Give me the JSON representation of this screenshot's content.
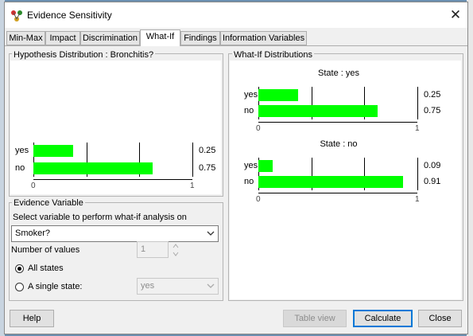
{
  "window": {
    "title": "Evidence Sensitivity"
  },
  "tabs": [
    {
      "label": "Min-Max"
    },
    {
      "label": "Impact"
    },
    {
      "label": "Discrimination"
    },
    {
      "label": "What-If",
      "active": true
    },
    {
      "label": "Findings"
    },
    {
      "label": "Information Variables"
    }
  ],
  "hypothesis": {
    "title": "Hypothesis Distribution : Bronchitis?",
    "chart_data": {
      "type": "bar",
      "categories": [
        "yes",
        "no"
      ],
      "values": [
        0.25,
        0.75
      ],
      "value_labels": [
        "0.25",
        "0.75"
      ],
      "xlim": [
        0,
        1
      ],
      "tick_labels": [
        "0",
        "1"
      ]
    }
  },
  "whatif": {
    "title": "What-If Distributions",
    "charts": [
      {
        "title": "State : yes",
        "chart_data": {
          "type": "bar",
          "categories": [
            "yes",
            "no"
          ],
          "values": [
            0.25,
            0.75
          ],
          "value_labels": [
            "0.25",
            "0.75"
          ],
          "xlim": [
            0,
            1
          ],
          "tick_labels": [
            "0",
            "1"
          ]
        }
      },
      {
        "title": "State : no",
        "chart_data": {
          "type": "bar",
          "categories": [
            "yes",
            "no"
          ],
          "values": [
            0.09,
            0.91
          ],
          "value_labels": [
            "0.09",
            "0.91"
          ],
          "xlim": [
            0,
            1
          ],
          "tick_labels": [
            "0",
            "1"
          ]
        }
      }
    ]
  },
  "evidence": {
    "title": "Evidence Variable",
    "instruction": "Select variable to perform what-if analysis on",
    "variable": "Smoker?",
    "num_values_label": "Number of values",
    "num_values": "1",
    "all_states_label": "All states",
    "single_state_label": "A single state:",
    "single_state_value": "yes"
  },
  "buttons": {
    "help": "Help",
    "table_view": "Table view",
    "calculate": "Calculate",
    "close": "Close"
  },
  "colors": {
    "bar": "#00ff00"
  }
}
